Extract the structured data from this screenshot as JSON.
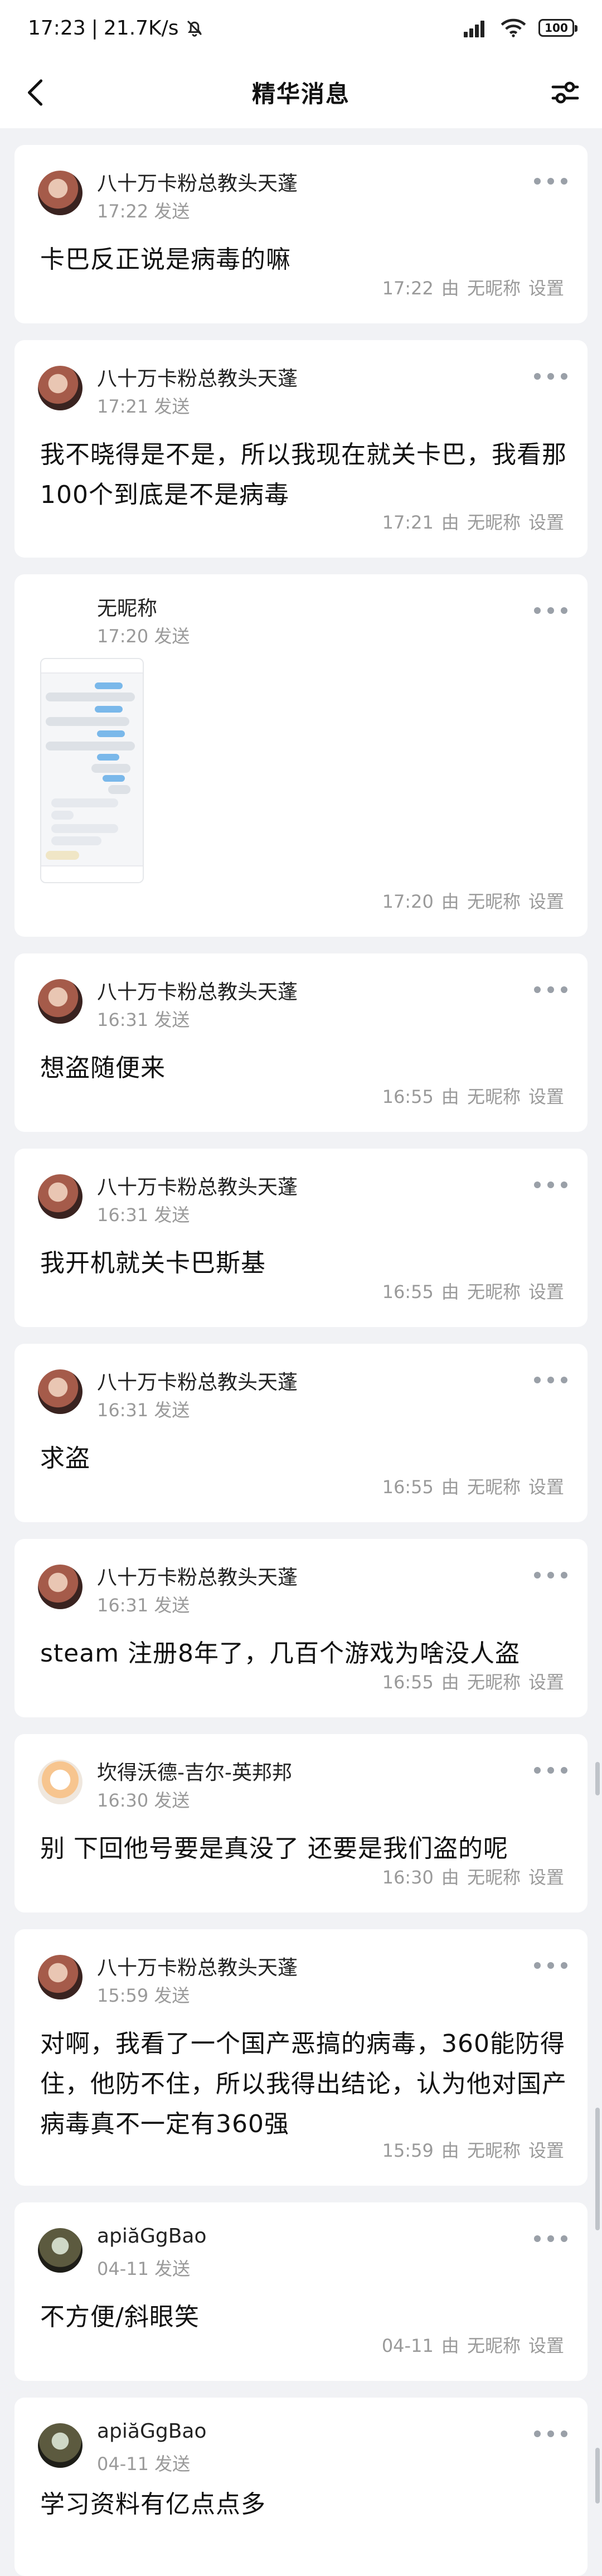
{
  "status": {
    "time": "17:23",
    "network_speed": "21.7K/s",
    "battery": "100"
  },
  "nav": {
    "title": "精华消息"
  },
  "messages": [
    {
      "name": "八十万卡粉总教头天蓬",
      "sent": "17:22 发送",
      "text": "卡巴反正说是病毒的嘛",
      "time": "17:22",
      "by": "由 无昵称",
      "setting": "设置"
    },
    {
      "name": "八十万卡粉总教头天蓬",
      "sent": "17:21 发送",
      "text": "我不晓得是不是，所以我现在就关卡巴，我看那100个到底是不是病毒",
      "time": "17:21",
      "by": "由 无昵称",
      "setting": "设置"
    },
    {
      "name": "无昵称",
      "sent": "17:20 发送",
      "text": "",
      "time": "17:20",
      "by": "由 无昵称",
      "setting": "设置"
    },
    {
      "name": "八十万卡粉总教头天蓬",
      "sent": "16:31 发送",
      "text": "想盗随便来",
      "time": "16:55",
      "by": "由 无昵称",
      "setting": "设置"
    },
    {
      "name": "八十万卡粉总教头天蓬",
      "sent": "16:31 发送",
      "text": "我开机就关卡巴斯基",
      "time": "16:55",
      "by": "由 无昵称",
      "setting": "设置"
    },
    {
      "name": "八十万卡粉总教头天蓬",
      "sent": "16:31 发送",
      "text": "求盗",
      "time": "16:55",
      "by": "由 无昵称",
      "setting": "设置"
    },
    {
      "name": "八十万卡粉总教头天蓬",
      "sent": "16:31 发送",
      "text": "steam 注册8年了，几百个游戏为啥没人盗",
      "time": "16:55",
      "by": "由 无昵称",
      "setting": "设置"
    },
    {
      "name": "坎得沃德-吉尔-英邦邦",
      "sent": "16:30 发送",
      "text": "别 下回他号要是真没了 还要是我们盗的呢",
      "time": "16:30",
      "by": "由 无昵称",
      "setting": "设置"
    },
    {
      "name": "八十万卡粉总教头天蓬",
      "sent": "15:59 发送",
      "text": "对啊，我看了一个国产恶搞的病毒，360能防得住，他防不住，所以我得出结论，认为他对国产病毒真不一定有360强",
      "time": "15:59",
      "by": "由 无昵称",
      "setting": "设置"
    },
    {
      "name": "apiăGgBao",
      "sent": "04-11 发送",
      "text": "不方便/斜眼笑",
      "time": "04-11",
      "by": "由 无昵称",
      "setting": "设置"
    },
    {
      "name": "apiăGgBao",
      "sent": "04-11 发送",
      "text": "学习资料有亿点点多",
      "time": "",
      "by": "",
      "setting": ""
    }
  ]
}
